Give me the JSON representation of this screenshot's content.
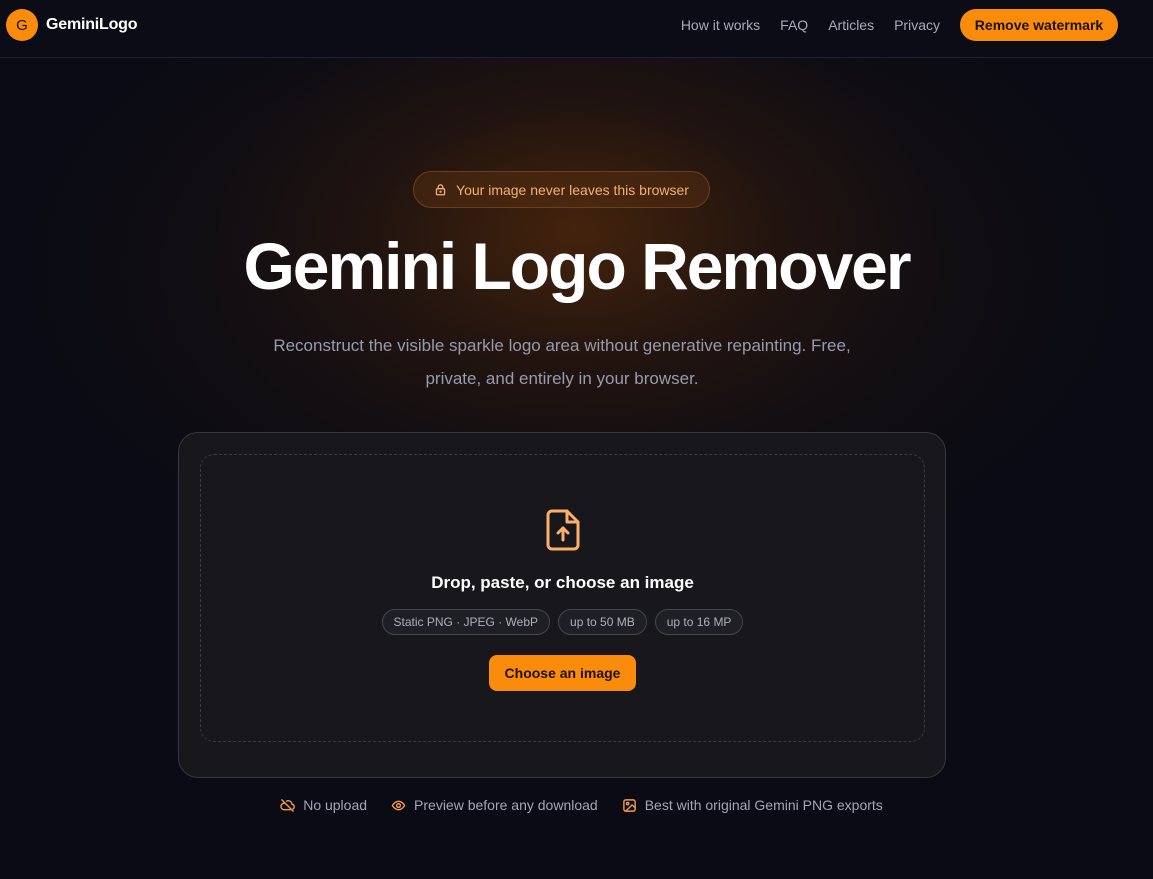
{
  "nav": {
    "brand_mark": "G",
    "brand_name": "GeminiLogo",
    "links": [
      "How it works",
      "FAQ",
      "Articles",
      "Privacy"
    ],
    "cta": "Remove watermark"
  },
  "hero": {
    "badge_icon": "lock-icon",
    "badge": "Your image never leaves this browser",
    "title": "Gemini Logo Remover",
    "subtitle": "Reconstruct the visible sparkle logo area without generative repainting. Free, private, and entirely in your browser."
  },
  "upload": {
    "icon": "file-upload-icon",
    "title": "Drop, paste, or choose an image",
    "chips": [
      "Static PNG · JPEG · WebP",
      "up to 50 MB",
      "up to 16 MP"
    ],
    "button": "Choose an image"
  },
  "features": [
    {
      "icon": "cloud-off-icon",
      "label": "No upload"
    },
    {
      "icon": "eye-icon",
      "label": "Preview before any download"
    },
    {
      "icon": "image-icon",
      "label": "Best with original Gemini PNG exports"
    }
  ],
  "colors": {
    "accent": "#fb8c0b",
    "background": "#0a0b14",
    "card": "#17171c",
    "badge_text": "#f3b26f"
  }
}
